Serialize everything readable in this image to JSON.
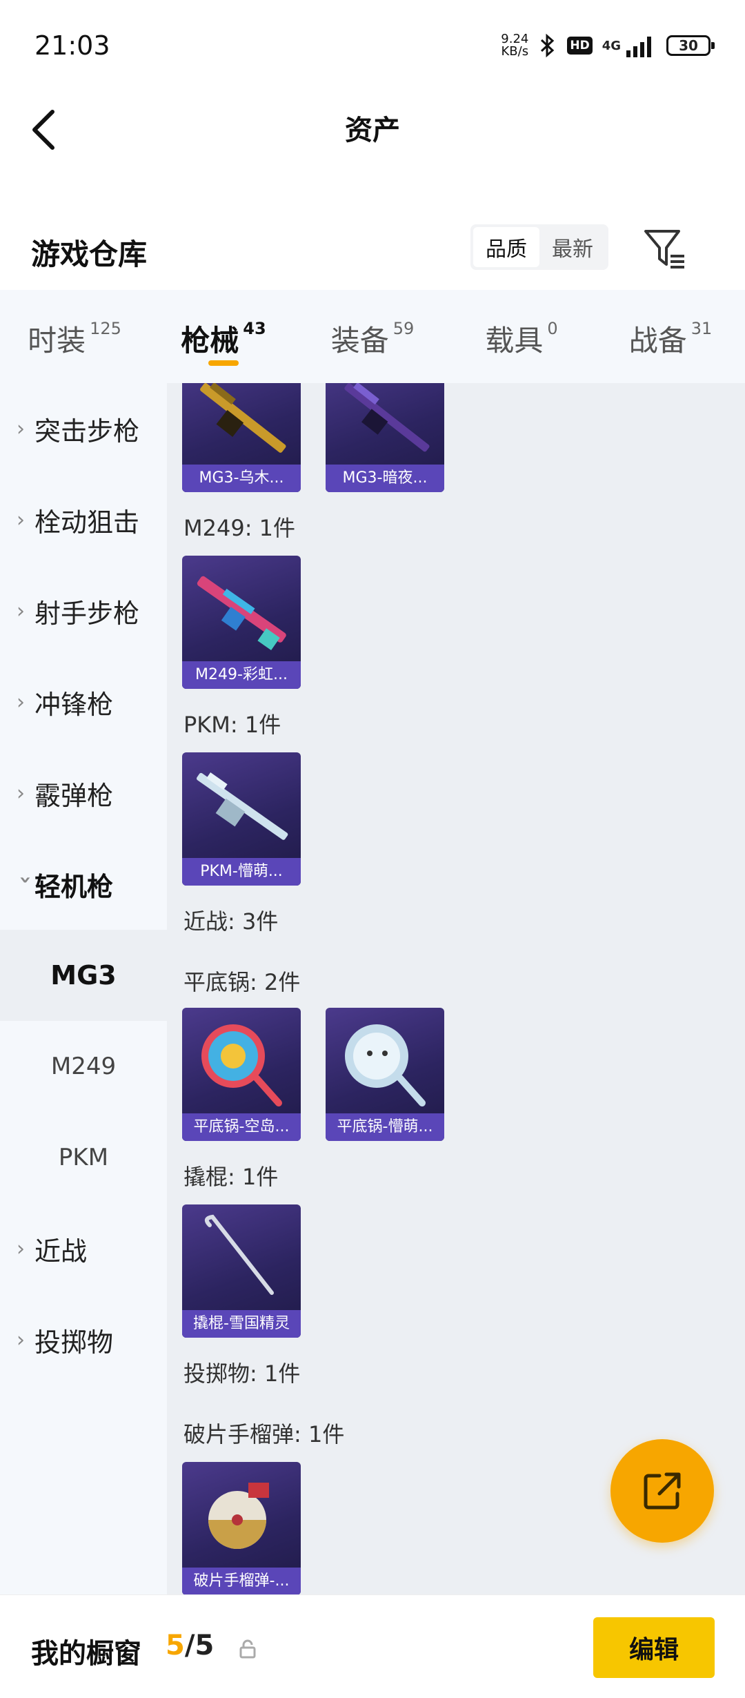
{
  "status_bar": {
    "time": "21:03",
    "net_speed_value": "9.24",
    "net_speed_unit": "KB/s",
    "hd": "HD",
    "network": "4G",
    "battery": "30"
  },
  "header": {
    "title": "资产",
    "back_icon": "chevron-left-icon"
  },
  "section": {
    "title": "游戏仓库",
    "sort_options": [
      "品质",
      "最新"
    ],
    "sort_selected": "品质",
    "filter_icon": "filter-icon"
  },
  "tabs": [
    {
      "label": "时装",
      "count": "125"
    },
    {
      "label": "枪械",
      "count": "43"
    },
    {
      "label": "装备",
      "count": "59"
    },
    {
      "label": "载具",
      "count": "0"
    },
    {
      "label": "战备",
      "count": "31"
    }
  ],
  "active_tab": "枪械",
  "sidebar": {
    "categories": [
      "突击步枪",
      "栓动狙击",
      "射手步枪",
      "冲锋枪",
      "霰弹枪",
      "轻机枪"
    ],
    "expanded": "轻机枪",
    "subitems": [
      "MG3",
      "M249",
      "PKM"
    ],
    "active_sub": "MG3",
    "more_categories": [
      "近战",
      "投掷物"
    ]
  },
  "content": {
    "groups": [
      {
        "label": "M249: 1件"
      },
      {
        "label": "PKM: 1件"
      },
      {
        "label": "近战: 3件"
      },
      {
        "label": "平底锅: 2件"
      },
      {
        "label": "撬棍: 1件"
      },
      {
        "label": "投掷物: 1件"
      },
      {
        "label": "破片手榴弹: 1件"
      }
    ],
    "items": [
      {
        "label": "MG3-乌木...",
        "art": "mg3-gold-gun-art"
      },
      {
        "label": "MG3-暗夜...",
        "art": "mg3-dark-gun-art"
      },
      {
        "label": "M249-彩虹...",
        "art": "m249-rainbow-gun-art"
      },
      {
        "label": "PKM-懵萌...",
        "art": "pkm-ice-gun-art"
      },
      {
        "label": "平底锅-空岛...",
        "art": "pan-colorful-art"
      },
      {
        "label": "平底锅-懵萌...",
        "art": "pan-cute-art"
      },
      {
        "label": "撬棍-雪国精灵",
        "art": "crowbar-art"
      },
      {
        "label": "破片手榴弹-...",
        "art": "grenade-art"
      }
    ]
  },
  "bottom_bar": {
    "label": "我的橱窗",
    "current": "5",
    "separator": "/",
    "total": "5",
    "edit_button": "编辑"
  },
  "colors": {
    "accent": "#f7a600",
    "edit_button": "#f7c600",
    "card_bg": "#2c2460",
    "card_label": "#5a46b8"
  }
}
